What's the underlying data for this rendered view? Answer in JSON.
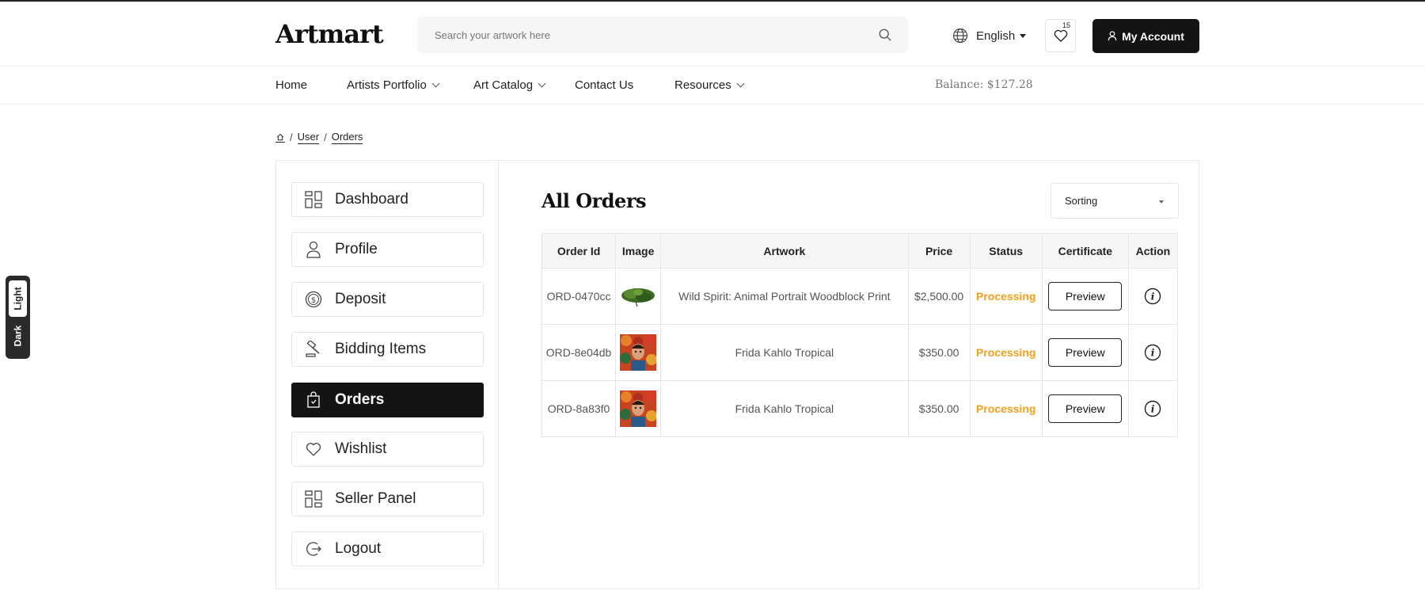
{
  "header": {
    "logo": "Artmart",
    "search_placeholder": "Search your artwork here",
    "language": "English",
    "wishlist_count": "15",
    "account_label": "My Account"
  },
  "nav": {
    "items": [
      {
        "label": "Home"
      },
      {
        "label": "Artists Portfolio"
      },
      {
        "label": "Art Catalog"
      },
      {
        "label": "Contact Us"
      },
      {
        "label": "Resources"
      }
    ],
    "balance": "Balance: $127.28"
  },
  "breadcrumb": {
    "items": [
      "User",
      "Orders"
    ],
    "separator": "/"
  },
  "sidebar": {
    "items": [
      {
        "label": "Dashboard",
        "icon": "grid-icon"
      },
      {
        "label": "Profile",
        "icon": "user-icon"
      },
      {
        "label": "Deposit",
        "icon": "dollar-coin-icon"
      },
      {
        "label": "Bidding Items",
        "icon": "gavel-icon"
      },
      {
        "label": "Orders",
        "icon": "shopping-bag-icon",
        "active": true
      },
      {
        "label": "Wishlist",
        "icon": "heart-icon"
      },
      {
        "label": "Seller Panel",
        "icon": "grid-icon"
      },
      {
        "label": "Logout",
        "icon": "logout-icon"
      }
    ]
  },
  "orders": {
    "title": "All Orders",
    "sorting_label": "Sorting",
    "columns": [
      "Order Id",
      "Image",
      "Artwork",
      "Price",
      "Status",
      "Certificate",
      "Action"
    ],
    "preview_label": "Preview",
    "rows": [
      {
        "id": "ORD-0470cc",
        "artwork": "Wild Spirit: Animal Portrait Woodblock Print",
        "price": "$2,500.00",
        "status": "Processing",
        "image": "green-foliage-thumbnail"
      },
      {
        "id": "ORD-8e04db",
        "artwork": "Frida Kahlo Tropical",
        "price": "$350.00",
        "status": "Processing",
        "image": "frida-portrait-thumbnail"
      },
      {
        "id": "ORD-8a83f0",
        "artwork": "Frida Kahlo Tropical",
        "price": "$350.00",
        "status": "Processing",
        "image": "frida-portrait-thumbnail"
      }
    ]
  },
  "theme_toggle": {
    "light": "Light",
    "dark": "Dark"
  },
  "colors": {
    "accent": "#141414",
    "status_processing": "#f0a01c"
  }
}
